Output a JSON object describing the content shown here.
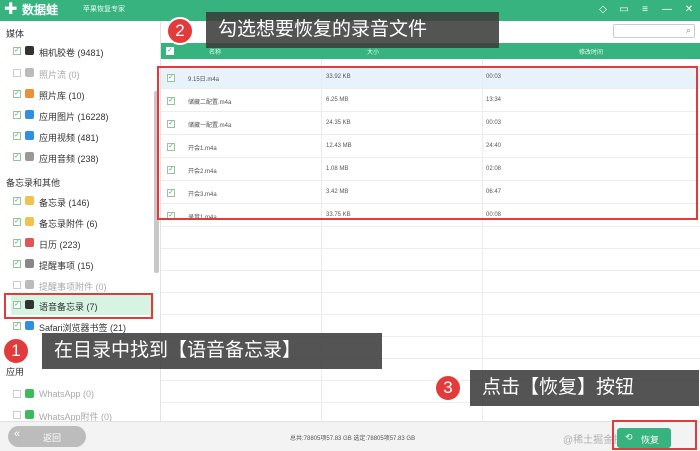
{
  "titlebar": {
    "logo_glyph": "✚",
    "app_name": "数据蛙",
    "subtitle": "苹果恢复专家",
    "icons": [
      "diamond-icon",
      "chat-icon",
      "menu-icon",
      "minimize-icon",
      "close-icon"
    ],
    "icon_glyphs": [
      "◇",
      "▭",
      "≡",
      "—",
      "✕"
    ]
  },
  "sidebar": {
    "sections": [
      {
        "title": "媒体"
      },
      {
        "title": "备忘录和其他"
      },
      {
        "title": "应用"
      }
    ],
    "items": [
      {
        "label": "相机胶卷 (9481)",
        "checked": true,
        "icon": "camera-roll-icon",
        "icon_color": "#333333"
      },
      {
        "label": "照片流 (0)",
        "checked": false,
        "icon": "photo-stream-icon",
        "icon_color": "#bbbbbb"
      },
      {
        "label": "照片库 (10)",
        "checked": true,
        "icon": "photo-library-icon",
        "icon_color": "#e8903a"
      },
      {
        "label": "应用图片 (16228)",
        "checked": true,
        "icon": "app-photos-icon",
        "icon_color": "#2f8fe0"
      },
      {
        "label": "应用视频 (481)",
        "checked": true,
        "icon": "app-videos-icon",
        "icon_color": "#2f8fe0"
      },
      {
        "label": "应用音频 (238)",
        "checked": true,
        "icon": "app-audio-icon",
        "icon_color": "#999999"
      },
      {
        "label": "备忘录 (146)",
        "checked": true,
        "icon": "notes-icon",
        "icon_color": "#f2c14e"
      },
      {
        "label": "备忘录附件 (6)",
        "checked": true,
        "icon": "notes-attachment-icon",
        "icon_color": "#f2c14e"
      },
      {
        "label": "日历 (223)",
        "checked": true,
        "icon": "calendar-icon",
        "icon_color": "#e25555"
      },
      {
        "label": "提醒事项 (15)",
        "checked": true,
        "icon": "reminders-icon",
        "icon_color": "#888888"
      },
      {
        "label": "提醒事项附件 (0)",
        "checked": false,
        "icon": "reminders-attachment-icon",
        "icon_color": "#bbbbbb"
      },
      {
        "label": "语音备忘录 (7)",
        "checked": true,
        "icon": "voice-memo-icon",
        "icon_color": "#333333",
        "active": true
      },
      {
        "label": "Safari浏览器书签 (21)",
        "checked": true,
        "icon": "safari-bookmark-icon",
        "icon_color": "#2f8fe0"
      },
      {
        "label": "WhatsApp (0)",
        "checked": false,
        "icon": "whatsapp-icon",
        "icon_color": "#3dbb58"
      },
      {
        "label": "WhatsApp附件 (0)",
        "checked": false,
        "icon": "whatsapp-attachment-icon",
        "icon_color": "#3dbb58"
      }
    ]
  },
  "main": {
    "table": {
      "headers": [
        "名称",
        "大小",
        "修改时间"
      ],
      "rows": [
        {
          "name": "9.15日.m4a",
          "size": "33.92 KB",
          "time": "00:03",
          "selected": true
        },
        {
          "name": "储藏二配置.m4a",
          "size": "6.25 MB",
          "time": "13:34"
        },
        {
          "name": "储藏一配置.m4a",
          "size": "24.35 KB",
          "time": "00:03"
        },
        {
          "name": "开会1.m4a",
          "size": "12.43 MB",
          "time": "24:40"
        },
        {
          "name": "开会2.m4a",
          "size": "1.08 MB",
          "time": "02:08"
        },
        {
          "name": "开会3.m4a",
          "size": "3.42 MB",
          "time": "06:47"
        },
        {
          "name": "录音1.m4a",
          "size": "33.75 KB",
          "time": "00:08"
        }
      ]
    }
  },
  "bottombar": {
    "back_label": "返回",
    "totals": "总共:78805项57.83 GB 选定:78805项57.83 GB",
    "recover_label": "恢复",
    "watermark": "@稀土掘金技术社区"
  },
  "annotations": [
    {
      "num": "1",
      "text": "在目录中找到【语音备忘录】"
    },
    {
      "num": "2",
      "text": "勾选想要恢复的录音文件"
    },
    {
      "num": "3",
      "text": "点击【恢复】按钮"
    }
  ],
  "colors": {
    "accent": "#36b37e",
    "annotation_red": "#e23b3b"
  }
}
